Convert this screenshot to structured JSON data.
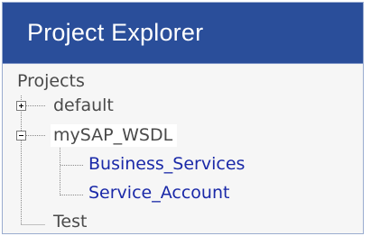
{
  "panel": {
    "title": "Project Explorer"
  },
  "tree": {
    "root_label": "Projects",
    "nodes": [
      {
        "label": "default",
        "state": "collapsed",
        "children": []
      },
      {
        "label": "mySAP_WSDL",
        "state": "expanded",
        "selected": true,
        "children": [
          {
            "label": "Business_Services"
          },
          {
            "label": "Service_Account"
          }
        ]
      },
      {
        "label": "Test",
        "state": "leaf",
        "children": []
      }
    ]
  },
  "colors": {
    "header_background": "#2a4e9a",
    "header_text": "#ffffff",
    "tree_background": "#f6f6f6",
    "project_text": "#4a4a4a",
    "service_link_text": "#1a29a8",
    "selection_background": "#ffffff"
  },
  "icons": {
    "collapsed_expander": "plus-box-icon",
    "expanded_expander": "minus-box-icon"
  }
}
